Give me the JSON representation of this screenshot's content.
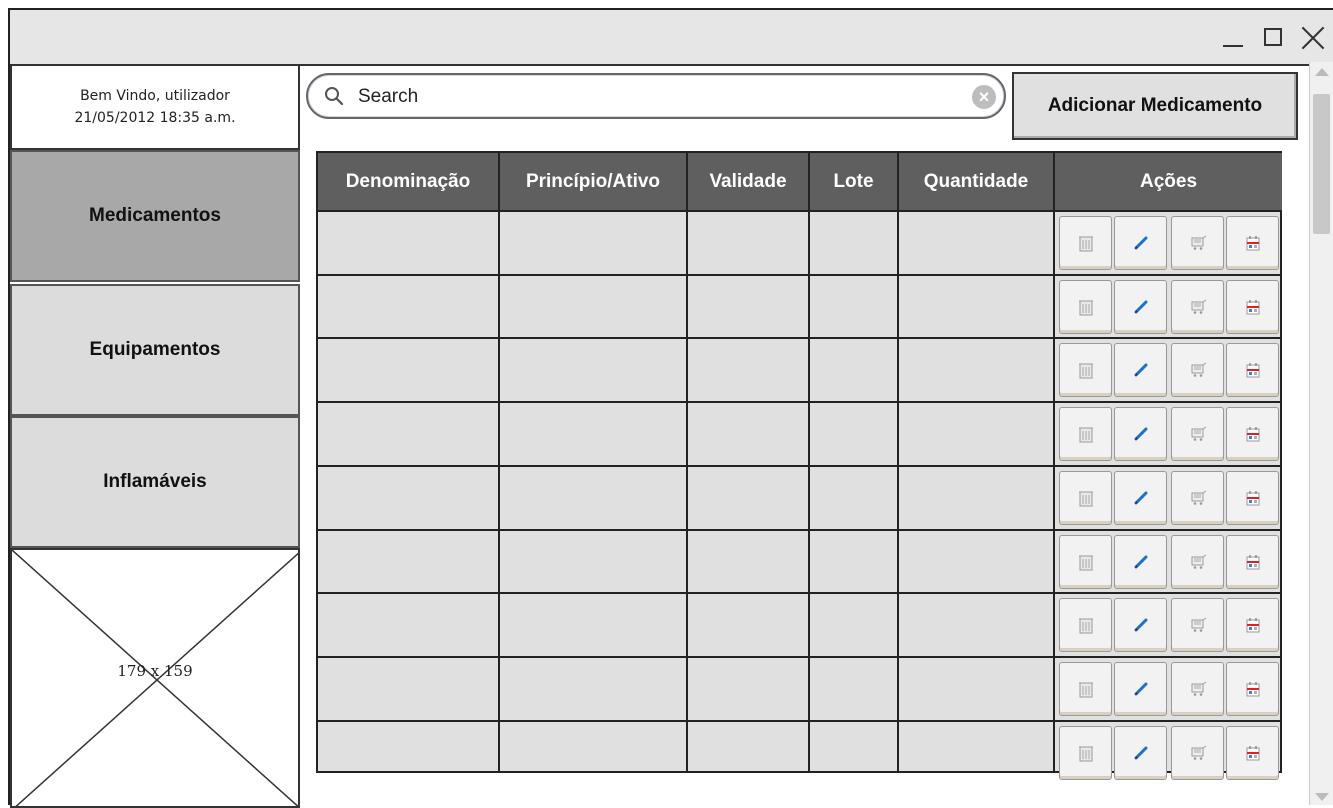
{
  "window": {
    "controls": [
      "minimize-icon",
      "maximize-icon",
      "close-icon"
    ]
  },
  "sidebar": {
    "welcome_line1": "Bem Vindo, utilizador",
    "welcome_line2": "21/05/2012 18:35 a.m.",
    "items": [
      {
        "label": "Medicamentos",
        "selected": true
      },
      {
        "label": "Equipamentos",
        "selected": false
      },
      {
        "label": "Inflamáveis",
        "selected": false
      }
    ],
    "image_placeholder": "179 x 159"
  },
  "search": {
    "placeholder": "Search"
  },
  "toolbar": {
    "add_label": "Adicionar Medicamento"
  },
  "table": {
    "columns": [
      "Denominação",
      "Princípio/Ativo",
      "Validade",
      "Lote",
      "Quantidade",
      "Ações"
    ],
    "row_count": 9,
    "row_action_icons": [
      "trash-icon",
      "edit-pencil-icon",
      "cart-icon",
      "calendar-icon"
    ]
  },
  "colors": {
    "header_bg": "#5f5f5f",
    "cell_bg": "#e0e0e0",
    "selected_nav": "#a8a8a8",
    "edit_icon": "#1f6fd1"
  }
}
